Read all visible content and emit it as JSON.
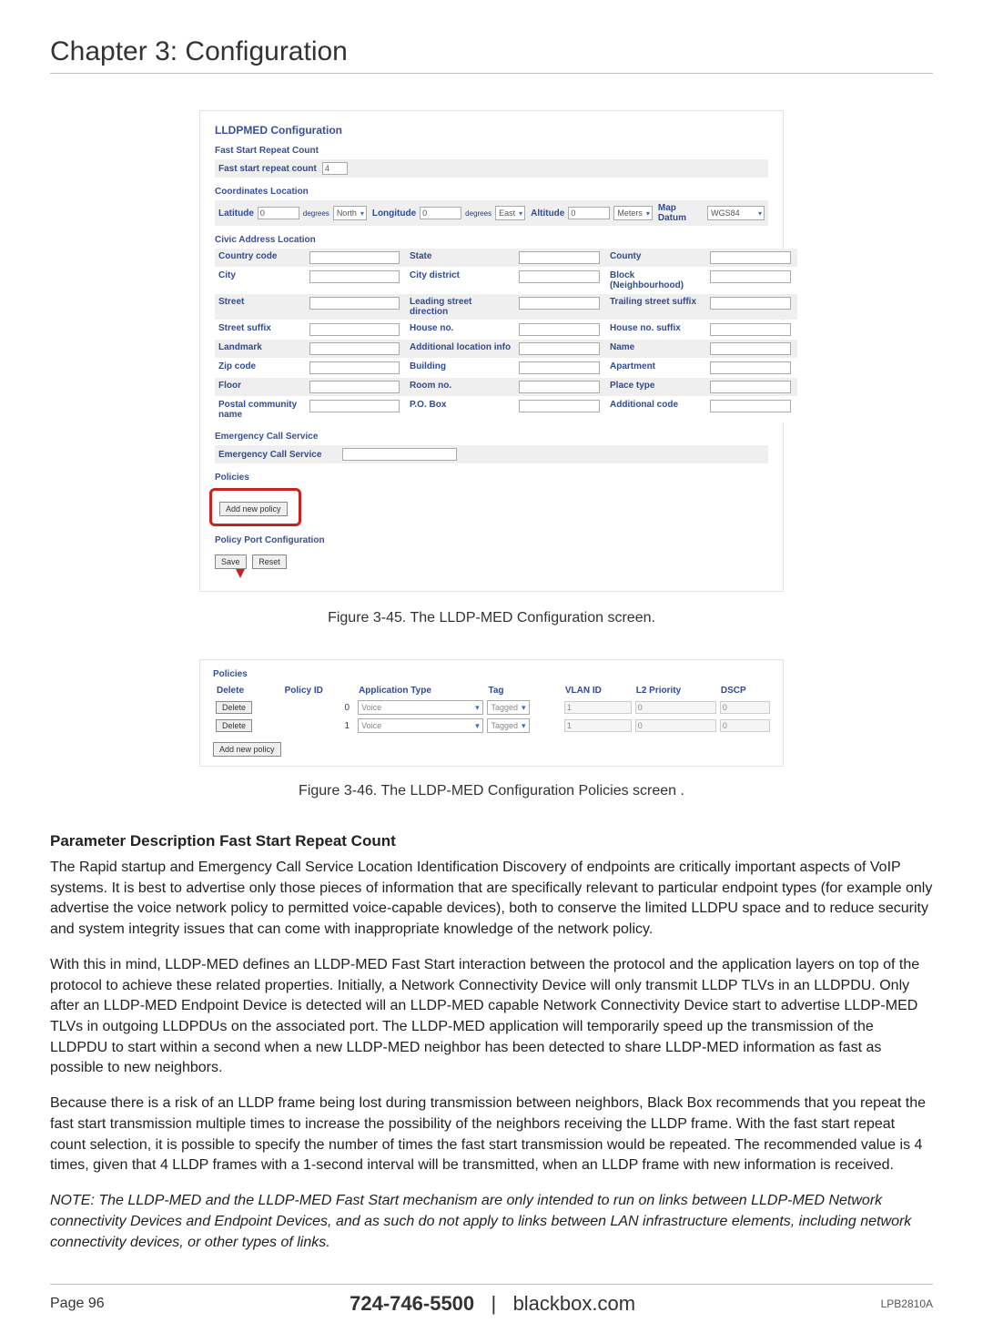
{
  "chapter": {
    "title": "Chapter 3: Configuration"
  },
  "screenshot1": {
    "title": "LLDPMED Configuration",
    "fast_start": {
      "section": "Fast Start Repeat Count",
      "label": "Fast start repeat count",
      "value": "4"
    },
    "coords": {
      "section": "Coordinates Location",
      "lat_label": "Latitude",
      "lat_value": "0",
      "lat_unit": "degrees",
      "lat_dir": "North",
      "lon_label": "Longitude",
      "lon_value": "0",
      "lon_unit": "degrees",
      "lon_dir": "East",
      "alt_label": "Altitude",
      "alt_value": "0",
      "alt_unit": "Meters",
      "datum_label": "Map Datum",
      "datum_value": "WGS84"
    },
    "civic": {
      "section": "Civic Address Location",
      "rows": [
        [
          "Country code",
          "State",
          "County"
        ],
        [
          "City",
          "City district",
          "Block (Neighbourhood)"
        ],
        [
          "Street",
          "Leading street direction",
          "Trailing street suffix"
        ],
        [
          "Street suffix",
          "House no.",
          "House no. suffix"
        ],
        [
          "Landmark",
          "Additional location info",
          "Name"
        ],
        [
          "Zip code",
          "Building",
          "Apartment"
        ],
        [
          "Floor",
          "Room no.",
          "Place type"
        ],
        [
          "Postal community name",
          "P.O. Box",
          "Additional code"
        ]
      ]
    },
    "emergency": {
      "section": "Emergency Call Service",
      "label": "Emergency Call Service"
    },
    "policies": {
      "section": "Policies",
      "add_btn": "Add new policy"
    },
    "port_conf": {
      "section": "Policy Port Configuration",
      "save_btn": "Save",
      "reset_btn": "Reset"
    }
  },
  "caption1": "Figure 3-45. The LLDP-MED Configuration screen.",
  "screenshot2": {
    "section": "Policies",
    "headers": [
      "Delete",
      "Policy ID",
      "Application Type",
      "Tag",
      "VLAN ID",
      "L2 Priority",
      "DSCP"
    ],
    "rows": [
      {
        "delete": "Delete",
        "policy_id": "0",
        "app_type": "Voice",
        "tag": "Tagged",
        "vlan": "1",
        "l2": "0",
        "dscp": "0"
      },
      {
        "delete": "Delete",
        "policy_id": "1",
        "app_type": "Voice",
        "tag": "Tagged",
        "vlan": "1",
        "l2": "0",
        "dscp": "0"
      }
    ],
    "add_btn": "Add new policy"
  },
  "caption2": "Figure 3-46. The LLDP-MED Configuration Policies screen .",
  "body": {
    "h1": "Parameter Description Fast Start Repeat Count",
    "p1": "The Rapid startup and Emergency Call Service Location Identification Discovery of endpoints are critically important aspects of VoIP systems. It is best to advertise only those pieces of information that are specifically relevant to particular endpoint types (for example only advertise the voice network policy to permitted voice-capable devices), both to conserve the limited LLDPU space and to reduce security and system integrity issues that can come with inappropriate knowledge of the network policy.",
    "p2": "With this in mind, LLDP-MED defines an LLDP-MED Fast Start interaction between the protocol and the application layers on top of the protocol to achieve these related properties. Initially, a Network Connectivity Device will only transmit LLDP TLVs in an LLDPDU. Only after an LLDP-MED Endpoint Device is detected will an LLDP-MED capable Network Connectivity Device start to advertise LLDP-MED TLVs in outgoing LLDPDUs on the associated port. The LLDP-MED application will temporarily speed up the transmission of the LLDPDU to start within a second when a new LLDP-MED neighbor has been detected to share LLDP-MED information as fast as possible to new neighbors.",
    "p3": "Because there is a risk of an LLDP frame being lost during transmission between neighbors, Black Box recommends that you repeat the fast start transmission multiple times to increase the possibility of the neighbors receiving the LLDP frame. With the fast start repeat count selection, it is possible to specify the number of times the fast start transmission would be repeated. The recommended value is 4 times, given that 4 LLDP frames with a 1-second interval will be transmitted, when an LLDP frame with new information is received.",
    "note": "NOTE: The LLDP-MED and the LLDP-MED Fast Start mechanism are only intended to run on links between LLDP-MED Network connectivity Devices and Endpoint Devices, and as such do not apply to links between LAN infrastructure elements, including network connectivity devices, or other types of links."
  },
  "footer": {
    "page": "Page 96",
    "phone": "724-746-5500",
    "sep": "|",
    "site": "blackbox.com",
    "model": "LPB2810A"
  }
}
